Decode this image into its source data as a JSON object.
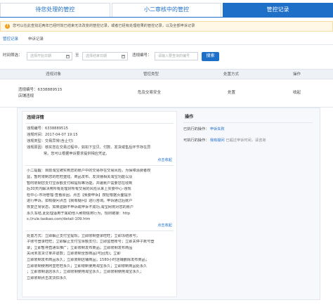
{
  "tabs": [
    {
      "label": "待您处理的管控",
      "active": false
    },
    {
      "label": "小二审核中的管控",
      "active": false
    },
    {
      "label": "管控记录",
      "active": true
    }
  ],
  "notice": {
    "text": "您可以在此查找近两年已经时效已结束无法改变的管控记录，或者已经有处理结果的管控记录，以及全部申诉记录"
  },
  "subtabs": [
    {
      "label": "管控记录",
      "active": true
    },
    {
      "label": "申诉记录",
      "active": false
    }
  ],
  "filter": {
    "time_label": "时间筛选：",
    "start_placeholder": "选择开始日期",
    "separator": "至",
    "end_placeholder": "选择结束日期",
    "id_label": "违规编号：",
    "id_placeholder": "请输入要查询的编号",
    "search_label": "搜索"
  },
  "table": {
    "headers": [
      "违规对象",
      "管控类型",
      "处置方式",
      "操作"
    ],
    "rows": [
      {
        "object_line1": "违规编号：6338889515",
        "object_line2": "店铺违规",
        "type": "危及交易安全",
        "action": "处置",
        "operation": "收起"
      }
    ]
  },
  "detail": {
    "left_title": "违规详情",
    "fields": [
      "违规编号：6338889515",
      "违规时间：2017-04-07 19:15",
      "违规类型：交易异常(含止付)",
      "违规原因：核实您在交易过程中，如扣下宝贝、付款、发货或售后环节存在异",
      "常。您可以根据申诉要求提供相应凭证。"
    ],
    "expand_label_1": "点击收起",
    "tips_title": "小二提醒：",
    "tips_lines": [
      "小二提醒：目前淘宝被实到您的账户中的交易存在交易风险，为保障消费者权",
      "益，暂时限制您的旺旺登陆、商品发布、发货播相关淘宝功能以及",
      "暂时限制您支付宝余额支付和提现等功能，并遭账户需要您在收到",
      "后30天内解决用所有处理好所有交易的风险从来上实要中心-违规",
      "检中心-市场管理-查看原因，点击【我要申诉】按钮根据页面提示",
      "进行申诉。如有疑问点击【我有疑问】进行咨询。申诉通过后账户",
      "恢复正常状态，如果逾期不申诉或申诉不成功,淘宝网将对您的账户",
      "永久冻结,此处理适用于属助他人刷物信用行为，规则链接：http",
      "s://rule.taobao.com/detail-109.htm"
    ],
    "expand_label_2": "点击收起",
    "measures_lines": [
      "处置方式：立即解止支付宝提现；立即限制登录旺旺；立即冻结账号；",
      "子账号登录旺旺；立即解止支付宝余额支付；立即监管账号；立即关停子账号登",
      "录；立即暂停直通车推广；立即限制发布商品；立即限制发布商品",
      "关闭未发货订单并退款；立即限制全部商品(可回流)；立即",
      "立即限制发布商品永久；立即限制店铺商品；1580小时店铺删除发布商品；",
      "立即限制使用阿里旺旺永久；立即限制使用淘宝永久；立即限制商品处永久",
      "；立即限制退店永久；立即限制使用淘宝永久；立即限制使用淘宝永久；",
      "立即限制点击发货扣永久"
    ],
    "right_title": "操作",
    "executed_label": "已执行的操作：",
    "executed_value": "申诉失败",
    "available_label": "可执行的操作：",
    "available_link": "我有疑问",
    "available_suffix": "已超过申诉时间，请咨询"
  },
  "colors": {
    "primary": "#1e6fc8",
    "notice_bg": "#fff8e6",
    "warn": "#f0a020"
  }
}
